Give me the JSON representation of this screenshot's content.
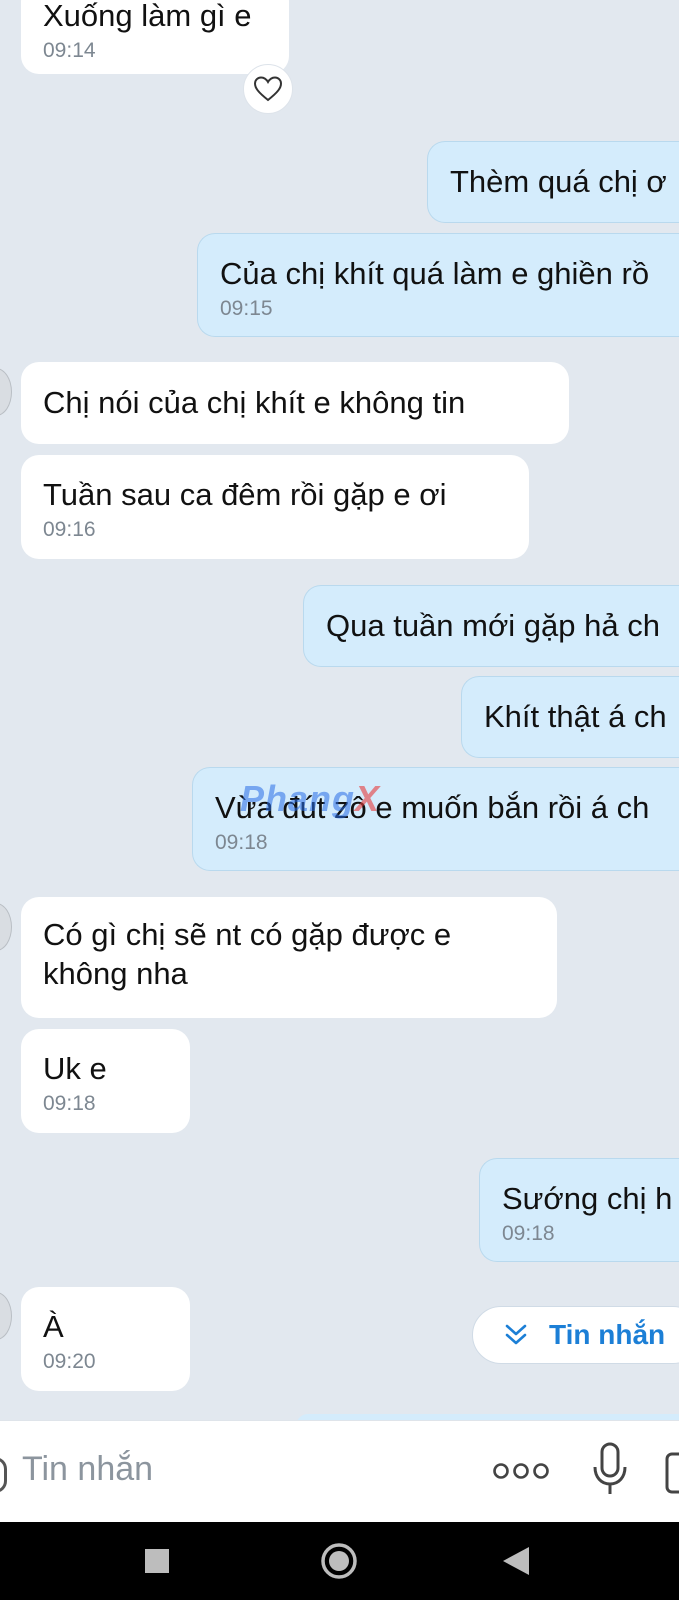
{
  "messages": [
    {
      "side": "in",
      "text": "Xuống  làm gì e",
      "time": "09:14"
    },
    {
      "side": "out",
      "text": "Thèm quá chị ơ",
      "time": ""
    },
    {
      "side": "out",
      "text": "Của chị khít quá làm e ghiền rồ",
      "time": "09:15"
    },
    {
      "side": "in",
      "text": "Chị  nói  của  chị  khít e không  tin",
      "time": ""
    },
    {
      "side": "in",
      "text": "Tuần sau  ca đêm  rồi  gặp e ơi",
      "time": "09:16"
    },
    {
      "side": "out",
      "text": "Qua tuần mới gặp hả ch",
      "time": ""
    },
    {
      "side": "out",
      "text": "Khít thật á ch",
      "time": ""
    },
    {
      "side": "out",
      "text": "Vừa đút zô e muốn bắn rồi á ch",
      "time": "09:18"
    },
    {
      "side": "in",
      "line1": "Có  gì  chị  sẽ  nt có  gặp  được e",
      "line2": "không  nha",
      "time": ""
    },
    {
      "side": "in",
      "text": "Uk e",
      "time": "09:18"
    },
    {
      "side": "out",
      "text": "Sướng chị h",
      "time": "09:18"
    },
    {
      "side": "in",
      "text": "À",
      "time": "09:20"
    }
  ],
  "jump_button": {
    "label": "Tin nhắn"
  },
  "input": {
    "placeholder": "Tin nhắn"
  },
  "watermark": {
    "main": "Phang",
    "x": "X"
  },
  "colors": {
    "incoming": "#ffffff",
    "outgoing": "#d4ecfc",
    "background": "#e2e8ef",
    "accent": "#1c7fd6"
  },
  "icons": [
    "heart-icon",
    "double-chevron-down-icon",
    "more-dots-icon",
    "microphone-icon",
    "image-icon",
    "square-nav-icon",
    "circle-nav-icon",
    "triangle-back-icon"
  ]
}
